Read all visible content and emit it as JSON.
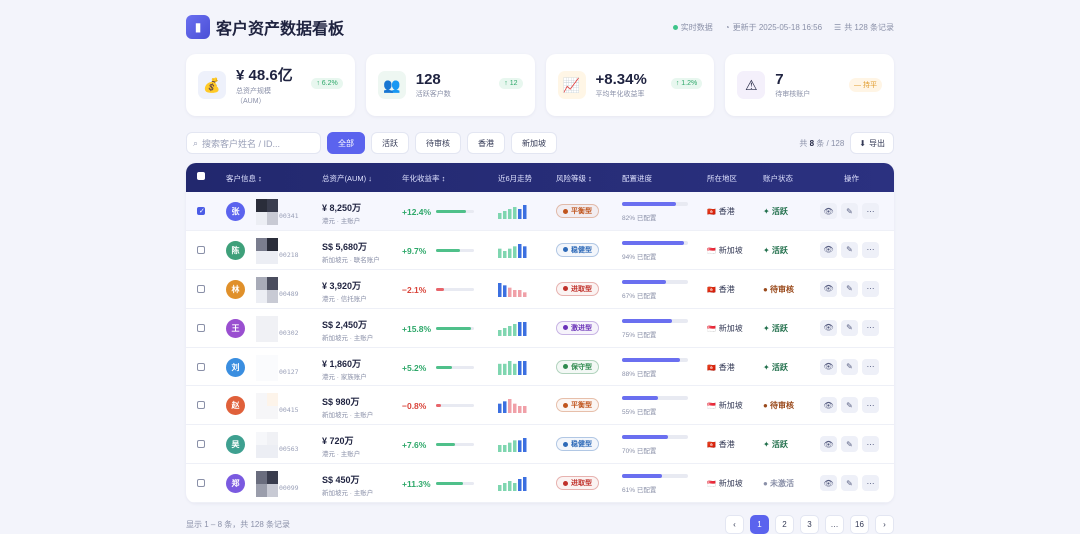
{
  "header": {
    "logo_icon": "chart-icon",
    "title": "客户资产数据看板",
    "live": "实时数据",
    "updated": "更新于 2025-05-18 16:56",
    "records": "共 128 条记录"
  },
  "kpis": [
    {
      "icon": "money-bag-icon",
      "value": "¥ 48.6亿",
      "label": "总资产规模",
      "label2": "（AUM）",
      "badge": "↑ 6.2%",
      "bg": "#eef1fb"
    },
    {
      "icon": "users-icon",
      "value": "128",
      "label": "活跃客户数",
      "label2": "",
      "badge": "↑ 12",
      "bg": "#eef7f2"
    },
    {
      "icon": "trend-chart-icon",
      "value": "+8.34%",
      "label": "平均年化收益率",
      "label2": "",
      "badge": "↑ 1.2%",
      "bg": "#fff6e6"
    },
    {
      "icon": "warning-icon",
      "value": "7",
      "label": "待审核账户",
      "label2": "",
      "badge": "— 持平",
      "bg": "#f4f0fb"
    }
  ],
  "toolbar": {
    "search_placeholder": "搜索客户姓名 / ID...",
    "filters": [
      "全部",
      "活跃",
      "待审核",
      "香港",
      "新加坡"
    ],
    "count_prefix": "共",
    "count_shown": "8",
    "count_suffix": "条 / 128",
    "export": "导出"
  },
  "table": {
    "headers": [
      "客户信息 ↕",
      "总资产(AUM) ↓",
      "年化收益率 ↕",
      "近6月走势",
      "风险等级 ↕",
      "配置进度",
      "所在地区",
      "账户状态",
      "操作"
    ],
    "rows": [
      {
        "checked": true,
        "avatar": "张",
        "avatar_color": "#5b63ee",
        "id": "00341",
        "amount": "¥ 8,250万",
        "sub": "港元 · 主账户",
        "yield": "+12.4%",
        "yield_value": 0.8,
        "up": true,
        "spark": [
          3,
          4,
          5,
          6,
          5,
          7
        ],
        "risk": "平衡型",
        "risk_color": "#c0541c",
        "progress": "82% 已配置",
        "progress_value": 0.82,
        "region_flag": "🇭🇰",
        "region": "香港",
        "status": "✦ 活跃",
        "status_color": "#1f6e4a"
      },
      {
        "checked": false,
        "avatar": "陈",
        "avatar_color": "#3ea07a",
        "id": "00218",
        "amount": "S$ 5,680万",
        "sub": "新加坡元 · 联名账户",
        "yield": "+9.7%",
        "yield_value": 0.62,
        "up": true,
        "spark": [
          4,
          3,
          4,
          5,
          6,
          5
        ],
        "risk": "稳健型",
        "risk_color": "#2e6ab8",
        "progress": "94% 已配置",
        "progress_value": 0.94,
        "region_flag": "🇸🇬",
        "region": "新加坡",
        "status": "✦ 活跃",
        "status_color": "#1f6e4a"
      },
      {
        "checked": false,
        "avatar": "林",
        "avatar_color": "#e0902a",
        "id": "00489",
        "amount": "¥ 3,920万",
        "sub": "港元 · 信托账户",
        "yield": "−2.1%",
        "yield_value": 0.2,
        "up": false,
        "spark": [
          6,
          5,
          4,
          3,
          3,
          2
        ],
        "risk": "进取型",
        "risk_color": "#c0302a",
        "progress": "67% 已配置",
        "progress_value": 0.67,
        "region_flag": "🇭🇰",
        "region": "香港",
        "status": "● 待审核",
        "status_color": "#9a4a1c"
      },
      {
        "checked": false,
        "avatar": "王",
        "avatar_color": "#9a4fd0",
        "id": "00302",
        "amount": "S$ 2,450万",
        "sub": "新加坡元 · 主账户",
        "yield": "+15.8%",
        "yield_value": 0.92,
        "up": true,
        "spark": [
          3,
          4,
          5,
          6,
          7,
          7
        ],
        "risk": "激进型",
        "risk_color": "#6a32b8",
        "progress": "75% 已配置",
        "progress_value": 0.75,
        "region_flag": "🇸🇬",
        "region": "新加坡",
        "status": "✦ 活跃",
        "status_color": "#1f6e4a"
      },
      {
        "checked": false,
        "avatar": "刘",
        "avatar_color": "#3a8ee0",
        "id": "00127",
        "amount": "¥ 1,860万",
        "sub": "港元 · 家族账户",
        "yield": "+5.2%",
        "yield_value": 0.42,
        "up": true,
        "spark": [
          4,
          4,
          5,
          4,
          5,
          5
        ],
        "risk": "保守型",
        "risk_color": "#2e8a4e",
        "progress": "88% 已配置",
        "progress_value": 0.88,
        "region_flag": "🇭🇰",
        "region": "香港",
        "status": "✦ 活跃",
        "status_color": "#1f6e4a"
      },
      {
        "checked": false,
        "avatar": "赵",
        "avatar_color": "#e0603a",
        "id": "00415",
        "amount": "S$ 980万",
        "sub": "新加坡元 · 主账户",
        "yield": "−0.8%",
        "yield_value": 0.14,
        "up": false,
        "spark": [
          4,
          5,
          6,
          4,
          3,
          3
        ],
        "risk": "平衡型",
        "risk_color": "#c0541c",
        "progress": "55% 已配置",
        "progress_value": 0.55,
        "region_flag": "🇸🇬",
        "region": "新加坡",
        "status": "● 待审核",
        "status_color": "#9a4a1c"
      },
      {
        "checked": false,
        "avatar": "吴",
        "avatar_color": "#3ea090",
        "id": "00563",
        "amount": "¥ 720万",
        "sub": "港元 · 主账户",
        "yield": "+7.6%",
        "yield_value": 0.5,
        "up": true,
        "spark": [
          3,
          3,
          4,
          5,
          5,
          6
        ],
        "risk": "稳健型",
        "risk_color": "#2e6ab8",
        "progress": "70% 已配置",
        "progress_value": 0.7,
        "region_flag": "🇭🇰",
        "region": "香港",
        "status": "✦ 活跃",
        "status_color": "#1f6e4a"
      },
      {
        "checked": false,
        "avatar": "郑",
        "avatar_color": "#7a5ae0",
        "id": "00099",
        "amount": "S$ 450万",
        "sub": "新加坡元 · 主账户",
        "yield": "+11.3%",
        "yield_value": 0.7,
        "up": true,
        "spark": [
          3,
          4,
          5,
          4,
          6,
          7
        ],
        "risk": "进取型",
        "risk_color": "#c0302a",
        "progress": "61% 已配置",
        "progress_value": 0.61,
        "region_flag": "🇸🇬",
        "region": "新加坡",
        "status": "● 未激活",
        "status_color": "#8a90a8"
      }
    ]
  },
  "footer": {
    "summary": "显示 1 – 8 条，共 128 条记录",
    "pages": [
      "‹",
      "1",
      "2",
      "3",
      "…",
      "16",
      "›"
    ],
    "current": "1"
  }
}
